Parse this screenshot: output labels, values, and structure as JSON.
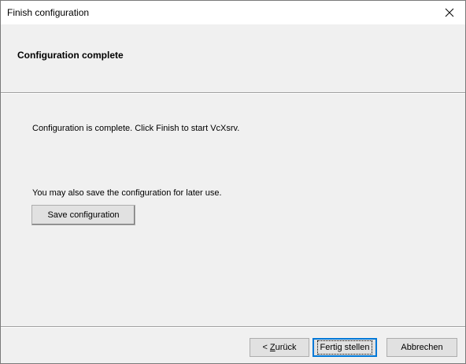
{
  "window": {
    "title": "Finish configuration"
  },
  "header": {
    "title": "Configuration complete"
  },
  "body": {
    "complete_message": "Configuration is complete. Click Finish to start VcXsrv.",
    "save_message": "You may also save the configuration for later use.",
    "save_button_label": "Save configuration"
  },
  "footer": {
    "back_prefix": "< ",
    "back_mnemonic": "Z",
    "back_rest": "urück",
    "finish_label": "Fertig stellen",
    "cancel_label": "Abbrechen"
  },
  "icons": {
    "close": "close-icon"
  }
}
